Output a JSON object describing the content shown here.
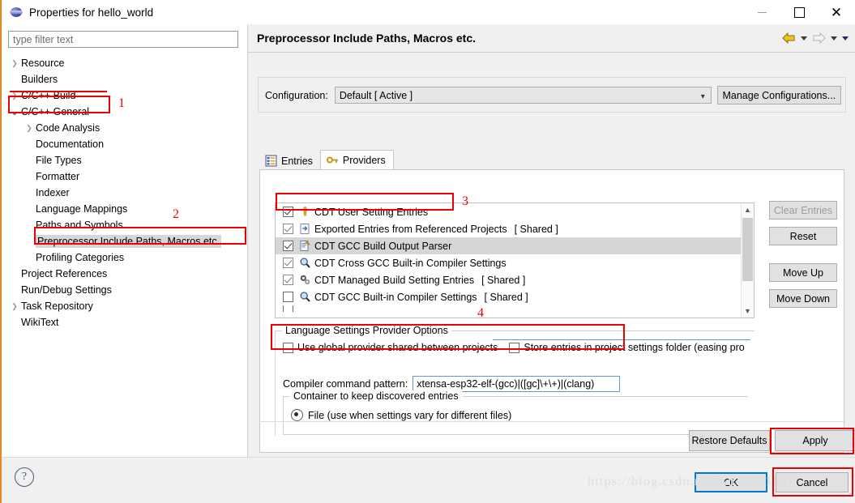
{
  "window": {
    "title": "Properties for hello_world",
    "icon": "eclipse-sphere-icon",
    "minimize": "—",
    "maximize": "□",
    "close": "✕"
  },
  "sidebar": {
    "filter_placeholder": "type filter text",
    "items": [
      {
        "label": "Resource",
        "indent": 0,
        "arrow": "right",
        "selected": false
      },
      {
        "label": "Builders",
        "indent": 0,
        "arrow": "none",
        "selected": false
      },
      {
        "label": "C/C++ Build",
        "indent": 0,
        "arrow": "right",
        "selected": false
      },
      {
        "label": "C/C++ General",
        "indent": 0,
        "arrow": "down",
        "selected": false
      },
      {
        "label": "Code Analysis",
        "indent": 1,
        "arrow": "right",
        "selected": false
      },
      {
        "label": "Documentation",
        "indent": 1,
        "arrow": "none",
        "selected": false
      },
      {
        "label": "File Types",
        "indent": 1,
        "arrow": "none",
        "selected": false
      },
      {
        "label": "Formatter",
        "indent": 1,
        "arrow": "none",
        "selected": false
      },
      {
        "label": "Indexer",
        "indent": 1,
        "arrow": "none",
        "selected": false
      },
      {
        "label": "Language Mappings",
        "indent": 1,
        "arrow": "none",
        "selected": false
      },
      {
        "label": "Paths and Symbols",
        "indent": 1,
        "arrow": "none",
        "selected": false
      },
      {
        "label": "Preprocessor Include Paths, Macros etc.",
        "indent": 1,
        "arrow": "none",
        "selected": true
      },
      {
        "label": "Profiling Categories",
        "indent": 1,
        "arrow": "none",
        "selected": false
      },
      {
        "label": "Project References",
        "indent": 0,
        "arrow": "none",
        "selected": false
      },
      {
        "label": "Run/Debug Settings",
        "indent": 0,
        "arrow": "none",
        "selected": false
      },
      {
        "label": "Task Repository",
        "indent": 0,
        "arrow": "right",
        "selected": false
      },
      {
        "label": "WikiText",
        "indent": 0,
        "arrow": "none",
        "selected": false
      }
    ]
  },
  "page": {
    "title": "Preprocessor Include Paths, Macros etc.",
    "nav": {
      "back_icon": "back-arrow-icon",
      "back_caret_icon": "chevron-down-icon",
      "forward_icon": "forward-arrow-icon",
      "forward_caret_icon": "chevron-down-icon",
      "menu_caret_icon": "chevron-down-icon"
    }
  },
  "configuration": {
    "label": "Configuration:",
    "value": "Default  [ Active ]",
    "caret_icon": "chevron-down-icon",
    "manage_button": "Manage Configurations..."
  },
  "tabs": [
    {
      "label": "Entries",
      "icon": "entries-list-icon",
      "active": false
    },
    {
      "label": "Providers",
      "icon": "key-icon",
      "active": true
    }
  ],
  "providers": {
    "rows": [
      {
        "checked": true,
        "icon": "user-figure-icon",
        "name": "CDT User Setting Entries",
        "shared": "",
        "highlight": false
      },
      {
        "checked": true,
        "icon": "export-document-icon",
        "name": "Exported Entries from Referenced Projects",
        "shared": "[ Shared ]",
        "highlight": false
      },
      {
        "checked": true,
        "icon": "document-pencil-icon",
        "name": "CDT GCC Build Output Parser",
        "shared": "",
        "highlight": true
      },
      {
        "checked": true,
        "icon": "magnifier-icon",
        "name": "CDT Cross GCC Built-in Compiler Settings",
        "shared": "",
        "highlight": false
      },
      {
        "checked": true,
        "icon": "gears-icon",
        "name": "CDT Managed Build Setting Entries",
        "shared": "[ Shared ]",
        "highlight": false
      },
      {
        "checked": false,
        "icon": "magnifier-icon",
        "name": "CDT GCC Built-in Compiler Settings",
        "shared": "[ Shared ]",
        "highlight": false
      }
    ],
    "scroll_up_icon": "chevron-up-icon",
    "scroll_down_icon": "chevron-down-icon"
  },
  "side_buttons": [
    {
      "label": "Clear Entries",
      "disabled": true
    },
    {
      "label": "Reset",
      "disabled": false
    },
    {
      "label": "Move Up",
      "disabled": false
    },
    {
      "label": "Move Down",
      "disabled": false
    }
  ],
  "options": {
    "group_title": "Language Settings Provider Options",
    "use_global_label": "Use global provider shared between projects",
    "use_global_checked": false,
    "store_entries_label": "Store entries in project settings folder (easing pro",
    "store_entries_checked": false,
    "compiler_pattern_label": "Compiler command pattern:",
    "compiler_pattern_value": "xtensa-esp32-elf-(gcc)|([gc]\\+\\+)|(clang)"
  },
  "container": {
    "group_title": "Container to keep discovered entries",
    "radio_label": "File (use when settings vary for different files)",
    "radio_selected": true
  },
  "footer_buttons": {
    "restore_defaults": "Restore Defaults",
    "apply": "Apply",
    "ok": "OK",
    "cancel": "Cancel",
    "help_icon": "help-question-icon"
  },
  "watermark": "https://blog.csdn.net/Andy001847",
  "annotations": [
    {
      "num": "1"
    },
    {
      "num": "2"
    },
    {
      "num": "3"
    },
    {
      "num": "4"
    }
  ],
  "colors": {
    "annotation_red": "#ee0000",
    "accent_orange": "#e08a28",
    "focus_blue": "#0078d7",
    "field_blue": "#5b9bd5",
    "selection_grey": "#d6d6d6"
  }
}
